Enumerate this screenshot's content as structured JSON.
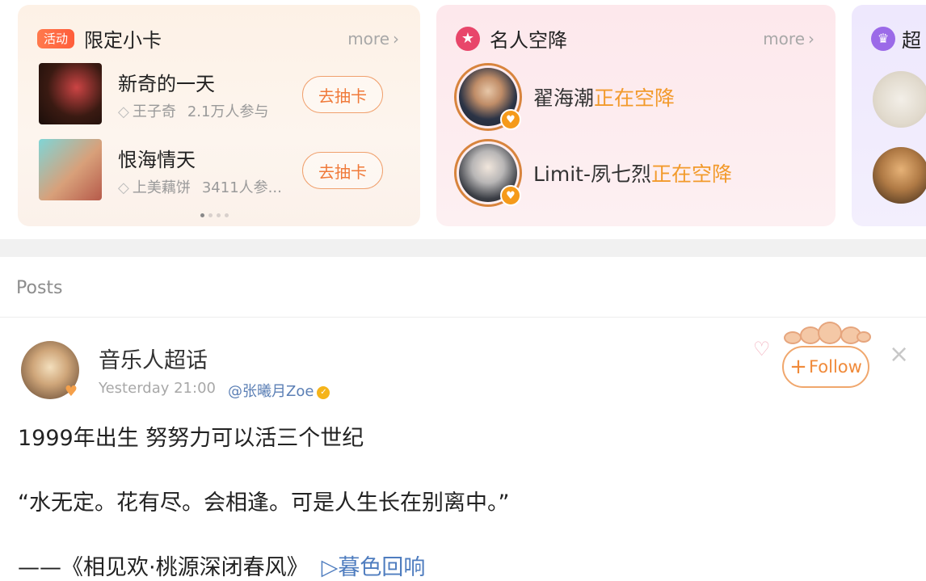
{
  "cards": {
    "limited": {
      "badge": "活动",
      "title": "限定小卡",
      "more": "more",
      "items": [
        {
          "title": "新奇的一天",
          "author": "王子奇",
          "participants": "2.1万人参与",
          "action": "去抽卡"
        },
        {
          "title": "恨海情天",
          "author": "上美藕饼",
          "participants": "3411人参...",
          "action": "去抽卡"
        }
      ]
    },
    "celebrity": {
      "title": "名人空降",
      "more": "more",
      "items": [
        {
          "name": "翟海潮",
          "status": "正在空降"
        },
        {
          "name": "Limit-夙七烈",
          "status": "正在空降"
        }
      ]
    },
    "third": {
      "title": "超"
    }
  },
  "posts": {
    "section_label": "Posts",
    "post": {
      "author": "音乐人超话",
      "time": "Yesterday 21:00",
      "mention": "@张曦月Zoe",
      "follow_label": "Follow",
      "lines": [
        "1999年出生 努努力可以活三个世纪",
        "“水无定。花有尽。会相逢。可是人生长在别离中。”",
        "——《相见欢·桃源深闭春风》"
      ],
      "music_link": "▷暮色回响"
    }
  },
  "colors": {
    "accent_orange": "#f08a3a",
    "live_text": "#f29a2b",
    "link_blue": "#4f7dbf"
  }
}
